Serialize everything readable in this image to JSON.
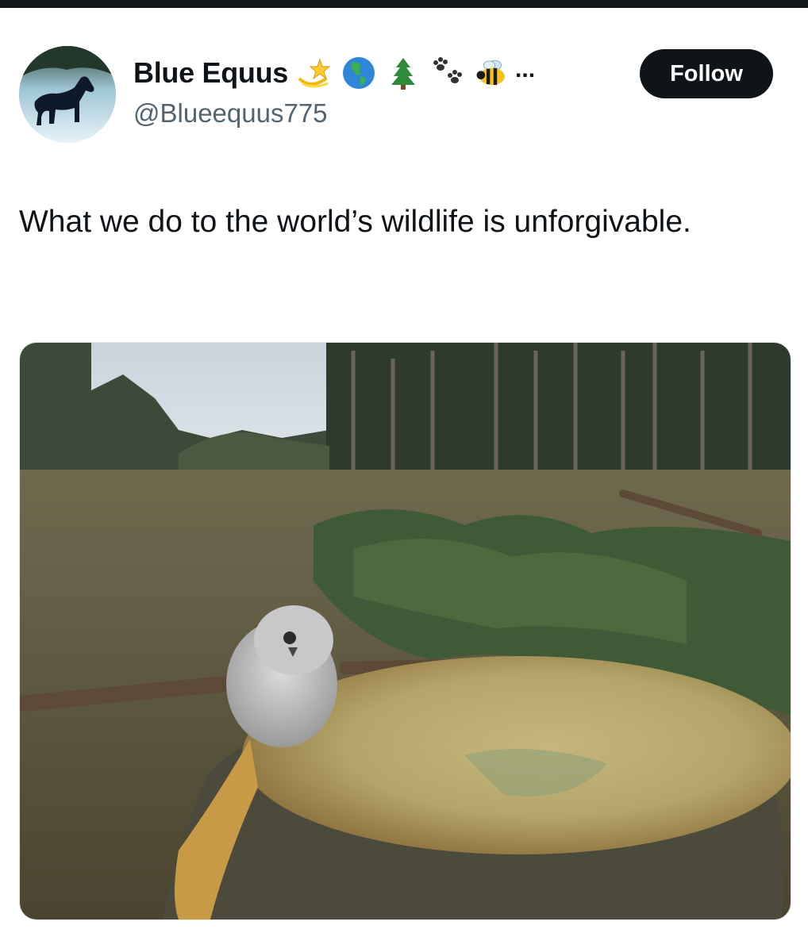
{
  "author": {
    "display_name": "Blue Equus",
    "handle": "@Blueequus775",
    "avatar": "horse-silhouette-avatar",
    "name_emojis": [
      "dizzy-star-emoji",
      "globe-americas-emoji",
      "evergreen-tree-emoji",
      "paw-prints-emoji",
      "honeybee-emoji"
    ],
    "name_truncation": "..."
  },
  "follow_button": {
    "label": "Follow"
  },
  "tweet": {
    "text": "What we do to the world’s wildlife is unforgivable."
  },
  "media": {
    "icon": "photo-owlet-on-tree-stump"
  },
  "colors": {
    "text_primary": "#0f1419",
    "text_secondary": "#536471",
    "follow_bg": "#0f1419",
    "follow_text": "#ffffff"
  }
}
